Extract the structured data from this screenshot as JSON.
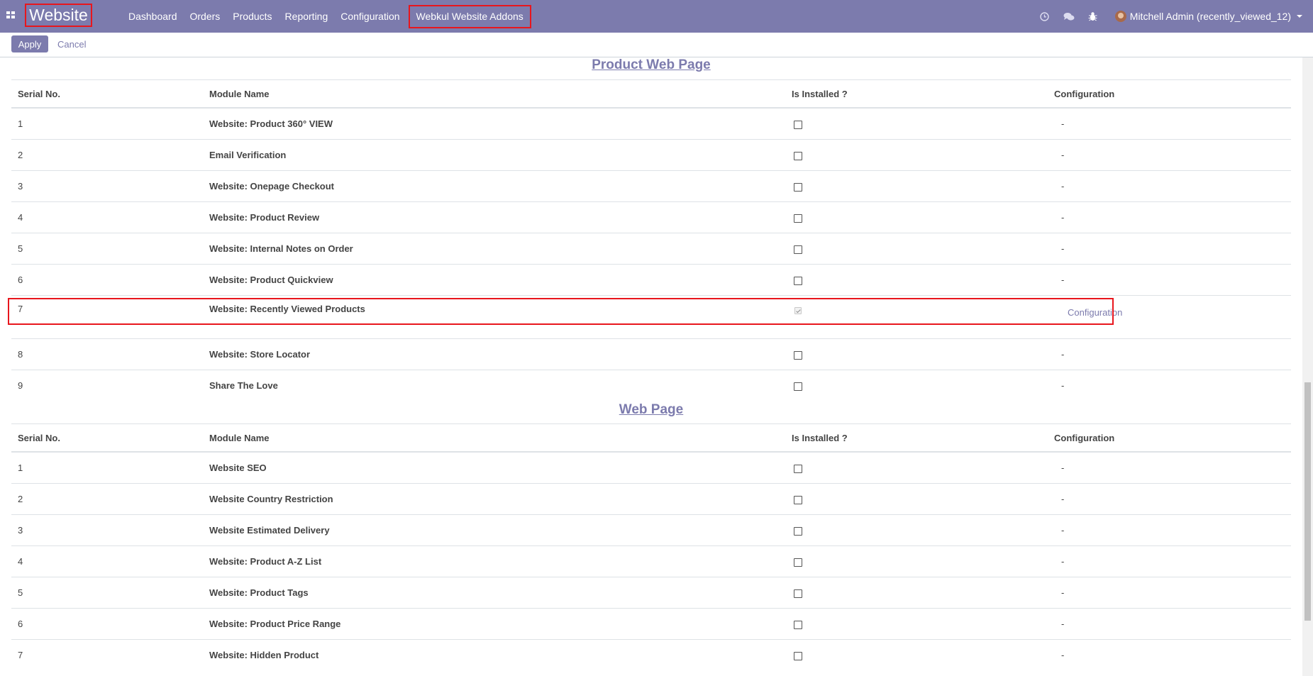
{
  "navbar": {
    "brand": "Website",
    "menu": [
      "Dashboard",
      "Orders",
      "Products",
      "Reporting",
      "Configuration"
    ],
    "addons_menu": "Webkul Website Addons",
    "user": "Mitchell Admin (recently_viewed_12)",
    "icons": [
      "clock-icon",
      "chat-icon",
      "bug-icon"
    ],
    "color": "#7c7bad"
  },
  "control_panel": {
    "apply_label": "Apply",
    "cancel_label": "Cancel"
  },
  "headers": {
    "serial": "Serial No.",
    "name": "Module Name",
    "installed": "Is Installed ?",
    "config": "Configuration"
  },
  "sections": [
    {
      "title": "Product Web Page",
      "rows": [
        {
          "serial": "1",
          "name": "Website: Product 360° VIEW",
          "installed": false,
          "config": "-"
        },
        {
          "serial": "2",
          "name": "Email Verification",
          "installed": false,
          "config": "-"
        },
        {
          "serial": "3",
          "name": "Website: Onepage Checkout",
          "installed": false,
          "config": "-"
        },
        {
          "serial": "4",
          "name": "Website: Product Review",
          "installed": false,
          "config": "-"
        },
        {
          "serial": "5",
          "name": "Website: Internal Notes on Order",
          "installed": false,
          "config": "-"
        },
        {
          "serial": "6",
          "name": "Website: Product Quickview",
          "installed": false,
          "config": "-"
        },
        {
          "serial": "7",
          "name": "Website: Recently Viewed Products",
          "installed": true,
          "config": "Configuration"
        },
        {
          "serial": "8",
          "name": "Website: Store Locator",
          "installed": false,
          "config": "-"
        },
        {
          "serial": "9",
          "name": "Share The Love",
          "installed": false,
          "config": "-"
        }
      ]
    },
    {
      "title": "Web Page",
      "rows": [
        {
          "serial": "1",
          "name": "Website SEO",
          "installed": false,
          "config": "-"
        },
        {
          "serial": "2",
          "name": "Website Country Restriction",
          "installed": false,
          "config": "-"
        },
        {
          "serial": "3",
          "name": "Website Estimated Delivery",
          "installed": false,
          "config": "-"
        },
        {
          "serial": "4",
          "name": "Website: Product A-Z List",
          "installed": false,
          "config": "-"
        },
        {
          "serial": "5",
          "name": "Website: Product Tags",
          "installed": false,
          "config": "-"
        },
        {
          "serial": "6",
          "name": "Website: Product Price Range",
          "installed": false,
          "config": "-"
        },
        {
          "serial": "7",
          "name": "Website: Hidden Product",
          "installed": false,
          "config": "-"
        }
      ]
    }
  ]
}
